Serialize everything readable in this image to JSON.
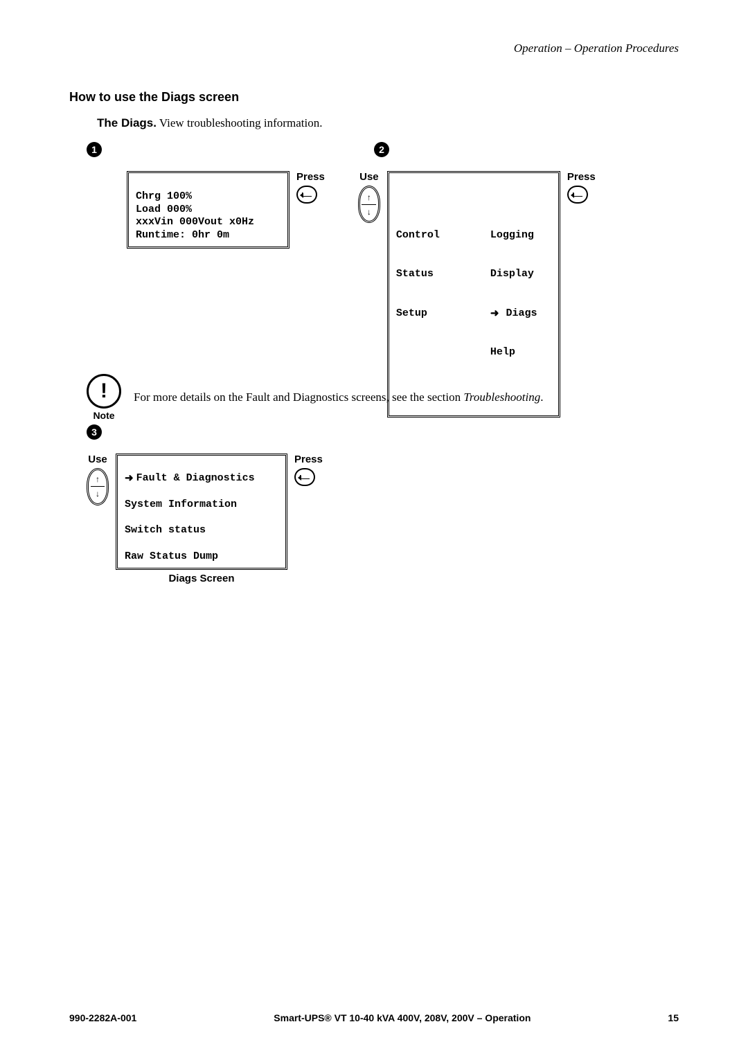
{
  "header": {
    "breadcrumb": "Operation – Operation Procedures"
  },
  "section": {
    "title": "How to use the Diags screen",
    "intro_bold": "The Diags.",
    "intro_rest": " View troubleshooting information."
  },
  "labels": {
    "press": "Press",
    "use": "Use"
  },
  "steps": {
    "one": {
      "num": "1",
      "screen_lines": [
        "Chrg 100%",
        "Load 000%",
        "xxxVin 000Vout x0Hz",
        "Runtime: 0hr 0m"
      ]
    },
    "two": {
      "num": "2",
      "menu_left": [
        "Control",
        "Status",
        "Setup"
      ],
      "menu_right": [
        "Logging",
        "Display",
        "Diags",
        "Help"
      ],
      "selected": "Diags"
    },
    "three": {
      "num": "3",
      "screen_lines": [
        "Fault & Diagnostics",
        "System Information",
        "Switch status",
        "Raw Status Dump"
      ],
      "caption": "Diags Screen",
      "selected_index": 0
    }
  },
  "note": {
    "label": "Note",
    "text_before": "For more details on the Fault and Diagnostics screens, see the section ",
    "text_italic": "Troubleshooting",
    "text_after": "."
  },
  "footer": {
    "doc_number": "990-2282A-001",
    "doc_title": "Smart-UPS® VT 10-40 kVA 400V, 208V, 200V – Operation",
    "page": "15"
  }
}
